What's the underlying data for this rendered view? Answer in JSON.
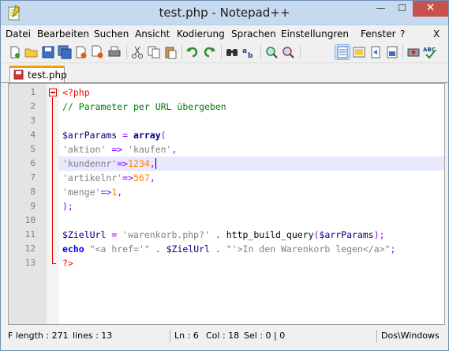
{
  "window": {
    "title": "test.php - Notepad++",
    "controls": {
      "minimize": "—",
      "maximize": "☐",
      "close": "✕"
    }
  },
  "menu": {
    "items": [
      "Datei",
      "Bearbeiten",
      "Suchen",
      "Ansicht",
      "Kodierung",
      "Sprachen",
      "Einstellungren",
      "Fenster",
      "?",
      "X"
    ]
  },
  "toolbar": {
    "buttons": [
      "new-file-icon",
      "open-folder-icon",
      "save-icon",
      "save-all-icon",
      "close-file-icon",
      "close-all-icon",
      "print-icon",
      "cut-icon",
      "copy-icon",
      "paste-icon",
      "undo-icon",
      "redo-icon",
      "find-icon",
      "replace-icon",
      "zoom-in-icon",
      "zoom-out-icon",
      "word-wrap-icon",
      "show-all-chars-icon",
      "indent-guide-icon",
      "doc-map-icon",
      "macro-record-icon",
      "spell-check-icon"
    ]
  },
  "tab": {
    "label": "test.php"
  },
  "editor": {
    "line_numbers": [
      "1",
      "2",
      "3",
      "4",
      "5",
      "6",
      "7",
      "8",
      "9",
      "10",
      "11",
      "12",
      "13"
    ],
    "current_line": 6,
    "lines": [
      [
        {
          "t": "<?php",
          "c": "php"
        }
      ],
      [
        {
          "t": "// Parameter per URL übergeben",
          "c": "cmt"
        }
      ],
      [],
      [
        {
          "t": "$arrParams",
          "c": "var"
        },
        {
          "t": " = ",
          "c": "op"
        },
        {
          "t": "array",
          "c": "fn"
        },
        {
          "t": "(",
          "c": "op"
        }
      ],
      [
        {
          "t": "'aktion'",
          "c": "str"
        },
        {
          "t": " => ",
          "c": "op"
        },
        {
          "t": "'kaufen'",
          "c": "str"
        },
        {
          "t": ",",
          "c": "op"
        }
      ],
      [
        {
          "t": "'kundennr'",
          "c": "str"
        },
        {
          "t": "=>",
          "c": "op"
        },
        {
          "t": "1234",
          "c": "num"
        },
        {
          "t": ",",
          "c": "op"
        }
      ],
      [
        {
          "t": "'artikelnr'",
          "c": "str"
        },
        {
          "t": "=>",
          "c": "op"
        },
        {
          "t": "567",
          "c": "num"
        },
        {
          "t": ",",
          "c": "op"
        }
      ],
      [
        {
          "t": "'menge'",
          "c": "str"
        },
        {
          "t": "=>",
          "c": "op"
        },
        {
          "t": "1",
          "c": "num"
        },
        {
          "t": ",",
          "c": "op"
        }
      ],
      [
        {
          "t": ");",
          "c": "op"
        }
      ],
      [],
      [
        {
          "t": "$ZielUrl",
          "c": "var"
        },
        {
          "t": " = ",
          "c": "op"
        },
        {
          "t": "'warenkorb.php?'",
          "c": "str"
        },
        {
          "t": " . ",
          "c": "op"
        },
        {
          "t": "http_build_query",
          "c": "def"
        },
        {
          "t": "(",
          "c": "op"
        },
        {
          "t": "$arrParams",
          "c": "var"
        },
        {
          "t": ");",
          "c": "op"
        }
      ],
      [
        {
          "t": "echo",
          "c": "kw"
        },
        {
          "t": " ",
          "c": "def"
        },
        {
          "t": "\"<a href='\"",
          "c": "str"
        },
        {
          "t": " . ",
          "c": "op"
        },
        {
          "t": "$ZielUrl",
          "c": "var"
        },
        {
          "t": " . ",
          "c": "op"
        },
        {
          "t": "\"'>In den Warenkorb legen</a>\"",
          "c": "str"
        },
        {
          "t": ";",
          "c": "op"
        }
      ],
      [
        {
          "t": "?>",
          "c": "php"
        }
      ]
    ]
  },
  "status": {
    "length": "F length : 271",
    "lines": "lines : 13",
    "ln": "Ln : 6",
    "col": "Col : 18",
    "sel": "Sel : 0 | 0",
    "eol": "Dos\\Windows"
  }
}
